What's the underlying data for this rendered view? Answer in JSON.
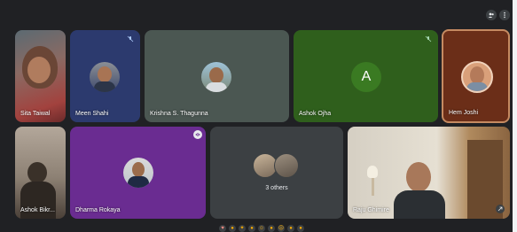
{
  "participants": [
    {
      "name": "Sita Taiwal"
    },
    {
      "name": "Meen Shahi"
    },
    {
      "name": "Krishna S. Thagunna"
    },
    {
      "name": "Ashok Ojha",
      "initial": "A"
    },
    {
      "name": "Hem Joshi"
    },
    {
      "name": "Ashok Bikr..."
    },
    {
      "name": "Dharma Rokaya"
    },
    {
      "name": "Raju Ghimire"
    }
  ],
  "others": {
    "label": "3 others"
  },
  "reactions": [
    "heart",
    "thumbs-up",
    "party",
    "clap",
    "laugh",
    "surprised",
    "sad",
    "thinking",
    "thumbs-down"
  ],
  "colors": {
    "background": "#202124",
    "tile_dark": "#3c4043",
    "navy_tile": "#2c3a6e",
    "green_tile": "#2f5f1c",
    "purple_tile": "#6a2c91",
    "speaker_border": "#c58a61"
  }
}
